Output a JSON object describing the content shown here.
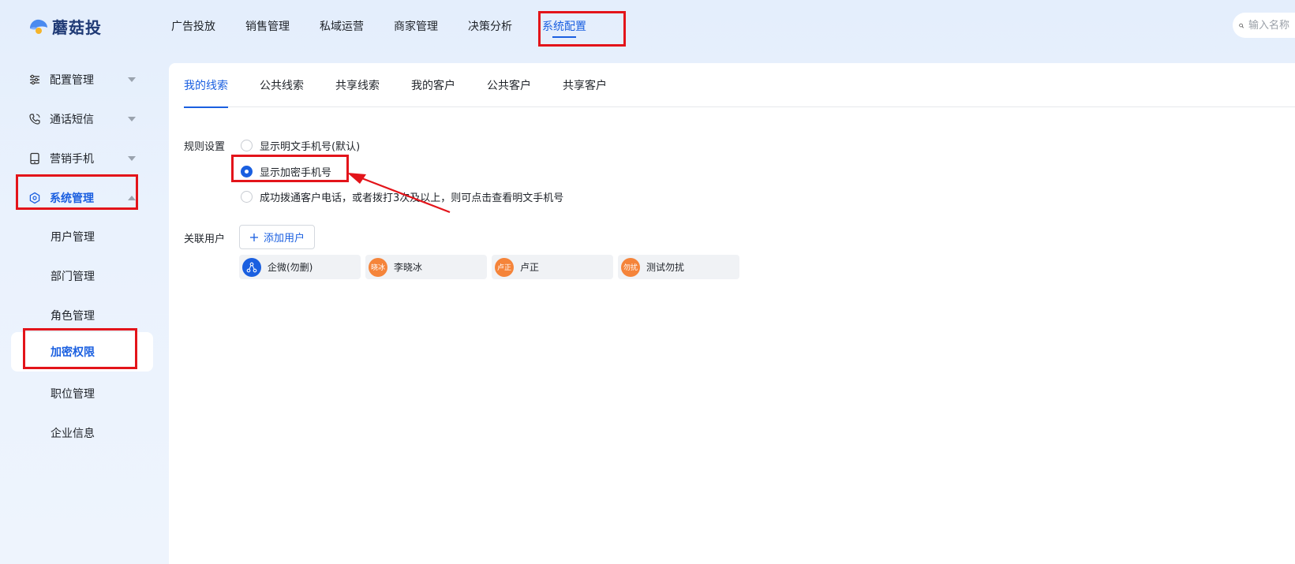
{
  "app": {
    "logo_text": "蘑菇投"
  },
  "nav": {
    "items": [
      "广告投放",
      "销售管理",
      "私域运营",
      "商家管理",
      "决策分析",
      "系统配置"
    ],
    "active_index": 5
  },
  "search": {
    "placeholder": "输入名称"
  },
  "sidebar": {
    "groups": [
      {
        "label": "配置管理",
        "icon": "sliders-icon"
      },
      {
        "label": "通话短信",
        "icon": "phone-icon"
      },
      {
        "label": "营销手机",
        "icon": "mobile-icon"
      },
      {
        "label": "系统管理",
        "icon": "hexagon-settings-icon"
      }
    ],
    "sub_items": [
      "用户管理",
      "部门管理",
      "角色管理",
      "加密权限",
      "职位管理",
      "企业信息"
    ],
    "selected_sub": "加密权限"
  },
  "tabs": [
    "我的线索",
    "公共线索",
    "共享线索",
    "我的客户",
    "公共客户",
    "共享客户"
  ],
  "rules": {
    "label": "规则设置",
    "options": [
      "显示明文手机号(默认)",
      "显示加密手机号",
      "成功拨通客户电话，或者拨打3次及以上，则可点击查看明文手机号"
    ],
    "selected_index": 1
  },
  "users": {
    "label": "关联用户",
    "add_label": "添加用户",
    "list": [
      {
        "name": "企微(勿删)",
        "avatar_text": "",
        "avatar_color": "#1a5fe0",
        "avatar_icon": "share-nodes-icon"
      },
      {
        "name": "李晓冰",
        "avatar_text": "晓冰",
        "avatar_color": "#f5843a"
      },
      {
        "name": "卢正",
        "avatar_text": "卢正",
        "avatar_color": "#f5843a"
      },
      {
        "name": "测试勿扰",
        "avatar_text": "勿扰",
        "avatar_color": "#f5843a"
      }
    ]
  },
  "colors": {
    "accent": "#1a5fe0",
    "highlight": "#e3141a",
    "avatar_orange": "#f5843a"
  }
}
